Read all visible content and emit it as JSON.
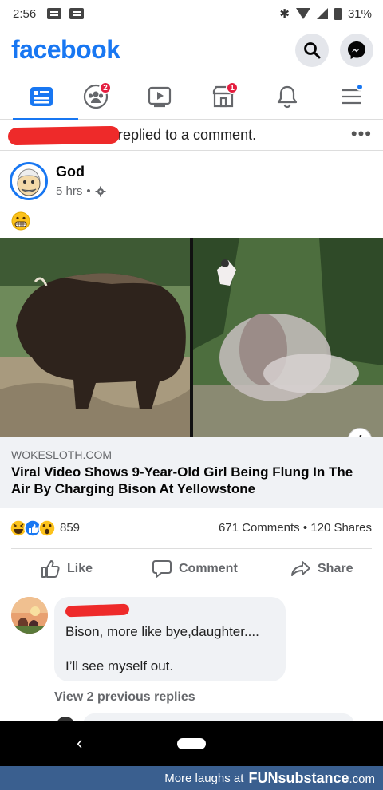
{
  "status_bar": {
    "time": "2:56",
    "battery": "31%"
  },
  "header": {
    "logo": "facebook"
  },
  "tabs": {
    "groups_badge": "2",
    "marketplace_badge": "1"
  },
  "activity": {
    "text": "replied to a comment.",
    "more": "•••"
  },
  "post": {
    "author": "God",
    "time": "5 hrs",
    "separator": "•",
    "emoji": "grimacing-face",
    "link": {
      "domain": "WOKESLOTH.COM",
      "title": "Viral Video Shows 9-Year-Old Girl Being Flung In The Air By Charging Bison At Yellowstone"
    },
    "reactions": {
      "count": "859",
      "types": [
        "haha",
        "like",
        "wow"
      ]
    },
    "stats": {
      "comments": "671 Comments",
      "dot": "•",
      "shares": "120 Shares"
    },
    "actions": {
      "like": "Like",
      "comment": "Comment",
      "share": "Share"
    }
  },
  "comment": {
    "line1": "Bison, more like bye,daughter....",
    "line2": "I’ll see myself out."
  },
  "view_replies": "View 2 previous replies",
  "watermark": {
    "prefix": "More laughs at",
    "brand": "FUNsubstance",
    "suffix": ".com"
  },
  "colors": {
    "brand_blue": "#1877f2",
    "badge_red": "#e41e3f",
    "watermark_bg": "#3a5f8f"
  }
}
